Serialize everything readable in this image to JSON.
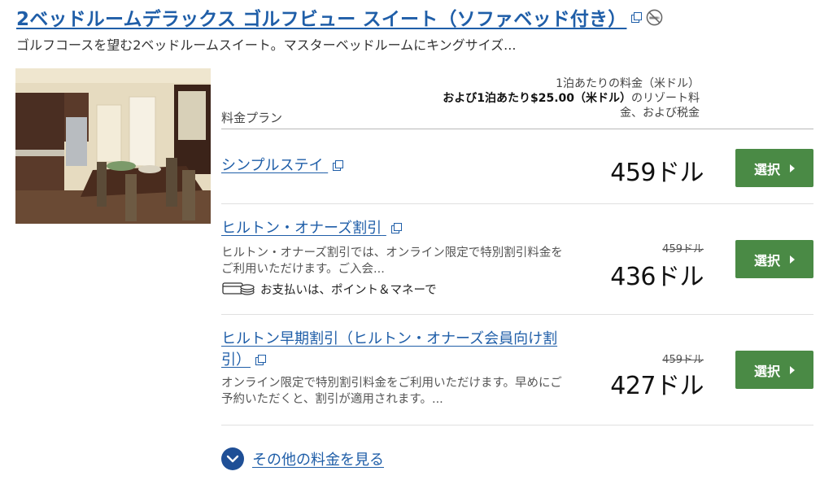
{
  "room": {
    "title": "2ベッドルームデラックス ゴルフビュー スイート（ソファベッド付き）",
    "description": "ゴルフコースを望む2ベッドルームスイート。マスターベッドルームにキングサイズ..."
  },
  "table_header": {
    "plan_label": "料金プラン",
    "rate_line1": "1泊あたりの料金（米ドル）",
    "rate_line2_bold": "および1泊あたり$25.00（米ドル）",
    "rate_line2_rest": "のリゾート料",
    "rate_line3": "金、および税金"
  },
  "rates": [
    {
      "name": "シンプルステイ",
      "description": "",
      "old_price": "",
      "price": "459ドル",
      "button": "選択"
    },
    {
      "name": "ヒルトン・オナーズ割引",
      "description_line1": "ヒルトン・オナーズ割引では、オンライン限定で特別割引料金を",
      "description_line2": "ご利用いただけます。ご入会...",
      "points_note": "お支払いは、ポイント＆マネーで",
      "old_price": "459ドル",
      "price": "436ドル",
      "button": "選択"
    },
    {
      "name_line1": "ヒルトン早期割引（ヒルトン・オナーズ会員向け割",
      "name_line2": "引）",
      "description_line1": "オンライン限定で特別割引料金をご利用いただけます。早めにご",
      "description_line2": "予約いただくと、割引が適用されます。...",
      "old_price": "459ドル",
      "price": "427ドル",
      "button": "選択"
    }
  ],
  "more_rates_label": "その他の料金を見る",
  "colors": {
    "link": "#1f5ea8",
    "select_button": "#4a8a45",
    "more_circle": "#1f4f96"
  },
  "icons": {
    "external_link": "external-link-icon",
    "no_smoking": "no-smoking-icon",
    "points_money": "points-money-icon",
    "chevron_down": "chevron-down-icon",
    "chevron_right": "chevron-right-icon"
  }
}
